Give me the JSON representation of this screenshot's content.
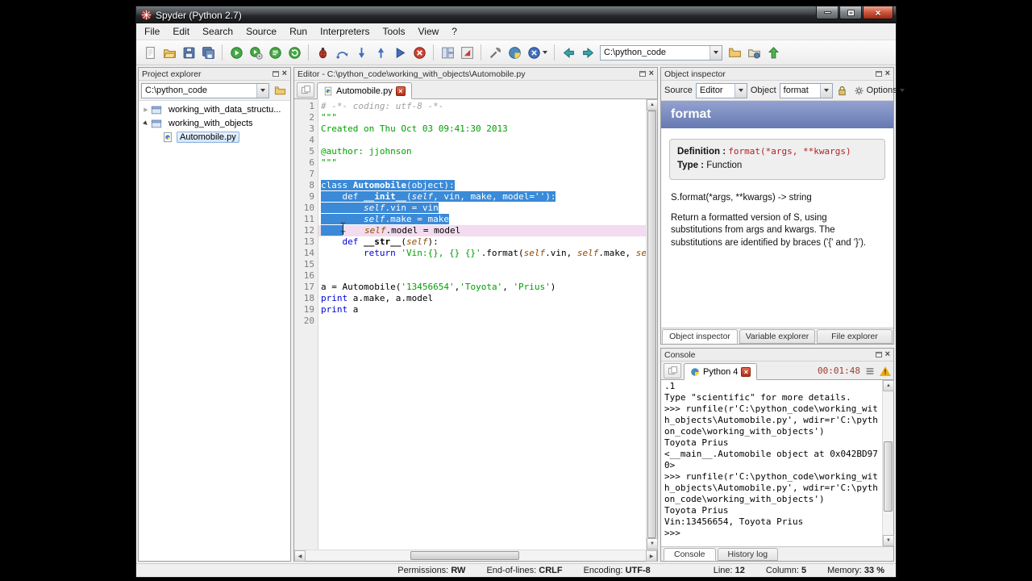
{
  "window": {
    "title": "Spyder (Python 2.7)"
  },
  "menu": [
    "File",
    "Edit",
    "Search",
    "Source",
    "Run",
    "Interpreters",
    "Tools",
    "View",
    "?"
  ],
  "toolbar": {
    "working_dir": "C:\\python_code",
    "buttons": [
      {
        "name": "new-file",
        "icon": "page"
      },
      {
        "name": "open-file",
        "icon": "open"
      },
      {
        "name": "save",
        "icon": "save"
      },
      {
        "name": "save-all",
        "icon": "saveall"
      },
      {
        "sep": true
      },
      {
        "name": "run",
        "icon": "run"
      },
      {
        "name": "run-settings",
        "icon": "runconf"
      },
      {
        "name": "run-selection",
        "icon": "runsel"
      },
      {
        "name": "rerun",
        "icon": "rerun"
      },
      {
        "sep": true
      },
      {
        "name": "debug",
        "icon": "bug"
      },
      {
        "name": "step-over",
        "icon": "stepover"
      },
      {
        "name": "step-into",
        "icon": "stepinto"
      },
      {
        "name": "step-out",
        "icon": "stepout"
      },
      {
        "name": "debug-continue",
        "icon": "cont"
      },
      {
        "name": "stop",
        "icon": "stop"
      },
      {
        "sep": true
      },
      {
        "name": "layout-grid",
        "icon": "grid"
      },
      {
        "name": "maximize-pane",
        "icon": "maxpane"
      },
      {
        "sep": true
      },
      {
        "name": "preferences",
        "icon": "tools"
      },
      {
        "name": "python-path-manager",
        "icon": "pypath"
      },
      {
        "name": "interpreter",
        "icon": "interp",
        "caret": true
      },
      {
        "sep": true
      },
      {
        "name": "back",
        "icon": "back"
      },
      {
        "name": "forward",
        "icon": "fwd"
      },
      {
        "combo": true
      },
      {
        "name": "browse-working-directory",
        "icon": "folder"
      },
      {
        "name": "set-console-directory",
        "icon": "setdir"
      },
      {
        "name": "parent-directory",
        "icon": "updir"
      }
    ]
  },
  "project": {
    "title": "Project explorer",
    "path": "C:\\python_code",
    "tree": [
      {
        "label": "working_with_data_structu...",
        "icon": "package",
        "arrow": "collapsed",
        "indent": 0,
        "selected": false
      },
      {
        "label": "working_with_objects",
        "icon": "package",
        "arrow": "expanded",
        "indent": 0,
        "selected": false
      },
      {
        "label": "Automobile.py",
        "icon": "pyfile",
        "arrow": "none",
        "indent": 1,
        "selected": true
      }
    ]
  },
  "editor": {
    "panel_title": "Editor - C:\\python_code\\working_with_objects\\Automobile.py",
    "tab": "Automobile.py",
    "lines": [
      {
        "tokens": [
          [
            "# -*- coding: utf-8 -*-",
            "c"
          ]
        ]
      },
      {
        "tokens": [
          [
            "\"\"\"",
            "s"
          ]
        ]
      },
      {
        "tokens": [
          [
            "Created on Thu Oct 03 09:41:30 2013",
            "s"
          ]
        ]
      },
      {
        "tokens": []
      },
      {
        "tokens": [
          [
            "@author: jjohnson",
            "s"
          ]
        ]
      },
      {
        "tokens": [
          [
            "\"\"\"",
            "s"
          ]
        ]
      },
      {
        "tokens": []
      },
      {
        "sel": true,
        "tokens": [
          [
            "class ",
            "k"
          ],
          [
            "Automobile",
            "d"
          ],
          [
            "(object):",
            "p"
          ]
        ]
      },
      {
        "sel": true,
        "tokens": [
          [
            "    ",
            "p"
          ],
          [
            "def ",
            "k"
          ],
          [
            "__init__",
            "d"
          ],
          [
            "(",
            "p"
          ],
          [
            "self",
            "i"
          ],
          [
            ", vin, make, model=",
            "p"
          ],
          [
            "''",
            "s"
          ],
          [
            "):",
            "p"
          ]
        ]
      },
      {
        "sel": true,
        "tokens": [
          [
            "        ",
            "p"
          ],
          [
            "self",
            "i"
          ],
          [
            ".vin = vin",
            "p"
          ]
        ]
      },
      {
        "sel": true,
        "tokens": [
          [
            "        ",
            "p"
          ],
          [
            "self",
            "i"
          ],
          [
            ".make = make",
            "p"
          ]
        ]
      },
      {
        "current": true,
        "tokens": [
          [
            "    ",
            "ss"
          ],
          [
            "",
            "caret"
          ],
          [
            "    ",
            "p"
          ],
          [
            "self",
            "i"
          ],
          [
            ".model = model",
            "p"
          ]
        ]
      },
      {
        "tokens": [
          [
            "    ",
            "p"
          ],
          [
            "def ",
            "k"
          ],
          [
            "__str__",
            "d"
          ],
          [
            "(",
            "p"
          ],
          [
            "self",
            "i"
          ],
          [
            "):",
            "p"
          ]
        ]
      },
      {
        "tokens": [
          [
            "        ",
            "p"
          ],
          [
            "return ",
            "k"
          ],
          [
            "'Vin:{}, {} {}'",
            "s"
          ],
          [
            ".format(",
            "p"
          ],
          [
            "self",
            "i"
          ],
          [
            ".vin, ",
            "p"
          ],
          [
            "self",
            "i"
          ],
          [
            ".make, ",
            "p"
          ],
          [
            "self",
            "i"
          ]
        ]
      },
      {
        "tokens": []
      },
      {
        "tokens": []
      },
      {
        "tokens": [
          [
            "a = Automobile(",
            "p"
          ],
          [
            "'13456654'",
            "s"
          ],
          [
            ",",
            "p"
          ],
          [
            "'Toyota'",
            "s"
          ],
          [
            ", ",
            "p"
          ],
          [
            "'Prius'",
            "s"
          ],
          [
            ")",
            "p"
          ]
        ]
      },
      {
        "tokens": [
          [
            "print",
            "k"
          ],
          [
            " a.make, a.model",
            "p"
          ]
        ]
      },
      {
        "tokens": [
          [
            "print",
            "k"
          ],
          [
            " a",
            "p"
          ]
        ]
      },
      {
        "tokens": []
      }
    ]
  },
  "inspector": {
    "title": "Object inspector",
    "source_label": "Source",
    "source_value": "Editor",
    "object_label": "Object",
    "object_value": "format",
    "options_label": "Options",
    "doc": {
      "name": "format",
      "definition_label": "Definition :",
      "definition": "format(*args, **kwargs)",
      "type_label": "Type :",
      "type_value": "Function",
      "signature": "S.format(*args, **kwargs) -> string",
      "body": "Return a formatted version of S, using substitutions from args and kwargs. The substitutions are identified by braces ('{' and '}')."
    },
    "tabs": [
      {
        "label": "Object inspector",
        "active": true
      },
      {
        "label": "Variable explorer",
        "active": false
      },
      {
        "label": "File explorer",
        "active": false
      }
    ]
  },
  "console": {
    "title": "Console",
    "tab": "Python 4",
    "timer": "00:01:48",
    "lines": [
      ".1",
      "Type \"scientific\" for more details.",
      ">>> runfile(r'C:\\python_code\\working_wit",
      "h_objects\\Automobile.py', wdir=r'C:\\pyth",
      "on_code\\working_with_objects')",
      "Toyota Prius",
      "<__main__.Automobile object at 0x042BD97",
      "0>",
      ">>> runfile(r'C:\\python_code\\working_wit",
      "h_objects\\Automobile.py', wdir=r'C:\\pyth",
      "on_code\\working_with_objects')",
      "Toyota Prius",
      "Vin:13456654, Toyota Prius",
      ">>>"
    ],
    "tabs": [
      {
        "label": "Console",
        "active": true
      },
      {
        "label": "History log",
        "active": false
      }
    ]
  },
  "statusbar": [
    {
      "label": "Permissions:",
      "value": "RW"
    },
    {
      "label": "End-of-lines:",
      "value": "CRLF"
    },
    {
      "label": "Encoding:",
      "value": "UTF-8"
    },
    {
      "label": "Line:",
      "value": "12"
    },
    {
      "label": "Column:",
      "value": "5"
    },
    {
      "label": "Memory:",
      "value": "33 %"
    }
  ]
}
